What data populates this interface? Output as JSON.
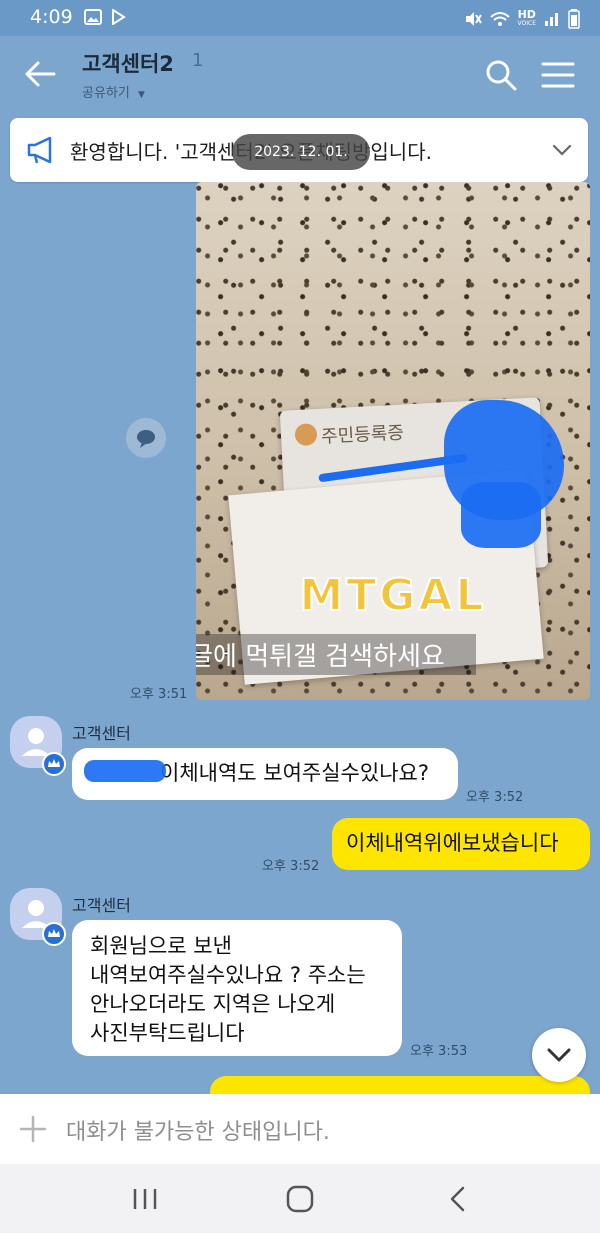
{
  "status": {
    "time": "4:09",
    "hd_label": "HD",
    "voice_label": "VOICE"
  },
  "header": {
    "title": "고객센터2",
    "member_count": "1",
    "share_label": "공유하기"
  },
  "notice": {
    "text": "환영합니다. '고객센터2' 오픈채팅방입니다.",
    "date_pill": "2023. 12. 01."
  },
  "photo": {
    "card_label": "주민등록증",
    "watermark_logo": "MTGAL",
    "watermark_caption": "구글에 먹튀갤 검색하세요"
  },
  "messages": [
    {
      "type": "time",
      "text": "오후 3:51"
    },
    {
      "type": "incoming",
      "sender": "고객센터",
      "text": "이체내역도 보여주실수있나요?",
      "time": "오후 3:52"
    },
    {
      "type": "outgoing",
      "text": "이체내역위에보냈습니다",
      "time": "오후 3:52"
    },
    {
      "type": "incoming",
      "sender": "고객센터",
      "lines": [
        "회원님으로 보낸",
        "내역보여주실수있나요 ? 주소는",
        "안나오더라도 지역은 나오게",
        "사진부탁드립니다"
      ],
      "time": "오후 3:53"
    }
  ],
  "input": {
    "placeholder": "대화가 불가능한 상태입니다."
  },
  "colors": {
    "chat_bg": "#7da6cf",
    "outgoing_bubble": "#fee500",
    "incoming_bubble": "#ffffff",
    "scribble": "#1b6cf2"
  }
}
